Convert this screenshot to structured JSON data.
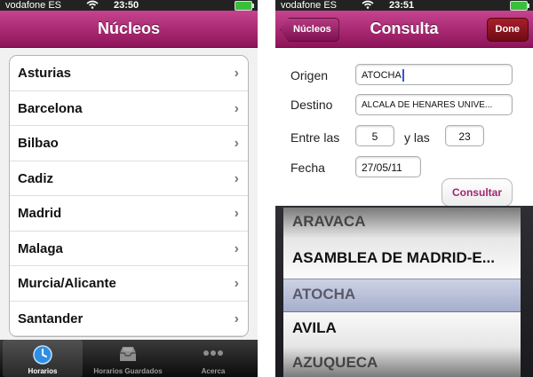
{
  "left_screen": {
    "status": {
      "carrier": "vodafone ES",
      "time": "23:50"
    },
    "nav_title": "Núcleos",
    "items": [
      "Asturias",
      "Barcelona",
      "Bilbao",
      "Cadiz",
      "Madrid",
      "Malaga",
      "Murcia/Alicante",
      "Santander"
    ],
    "chevron": "›",
    "tabs": [
      {
        "label": "Horarios",
        "icon": "clock-icon",
        "active": true
      },
      {
        "label": "Horarios Guardados",
        "icon": "inbox-icon",
        "active": false
      },
      {
        "label": "Acerca",
        "icon": "more-icon",
        "active": false
      }
    ]
  },
  "right_screen": {
    "status": {
      "carrier": "vodafone ES",
      "time": "23:51"
    },
    "nav_title": "Consulta",
    "back_label": "Núcleos",
    "done_label": "Done",
    "form": {
      "origen_label": "Origen",
      "origen_value": "ATOCHA",
      "destino_label": "Destino",
      "destino_value": "ALCALA DE HENARES UNIVE...",
      "entre_label": "Entre las",
      "entre_value": "5",
      "y_label": "y las",
      "y_value": "23",
      "fecha_label": "Fecha",
      "fecha_value": "27/05/11",
      "consultar_label": "Consultar"
    },
    "picker_items": [
      "ARAVACA",
      "ASAMBLEA DE MADRID-E...",
      "ATOCHA",
      "AVILA",
      "AZUQUECA"
    ],
    "picker_selected": "ATOCHA"
  },
  "colors": {
    "accent": "#a3266f",
    "navbar": "#b0347a",
    "done": "#8c1420"
  }
}
